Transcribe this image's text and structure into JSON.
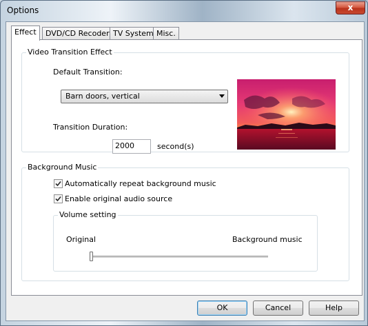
{
  "window": {
    "title": "Options",
    "close_glyph": "x"
  },
  "tabs": [
    {
      "label": "Effect",
      "active": true
    },
    {
      "label": "DVD/CD Recoder",
      "active": false
    },
    {
      "label": "TV System",
      "active": false
    },
    {
      "label": "Misc.",
      "active": false
    }
  ],
  "video_transition": {
    "group_title": "Video Transition Effect",
    "default_transition_label": "Default Transition:",
    "default_transition_value": "Barn doors, vertical",
    "duration_label": "Transition Duration:",
    "duration_value": "2000",
    "duration_unit": "second(s)",
    "preview_image": "sunset-preview"
  },
  "background_music": {
    "group_title": "Background Music",
    "repeat_label": "Automatically repeat background music",
    "repeat_checked": true,
    "original_audio_label": "Enable original audio source",
    "original_audio_checked": true,
    "volume": {
      "group_title": "Volume setting",
      "left_label": "Original",
      "right_label": "Background music",
      "level": 0
    }
  },
  "buttons": {
    "ok": "OK",
    "cancel": "Cancel",
    "help": "Help"
  },
  "colors": {
    "accent": "#3c7fb1",
    "close_button": "#c84a30"
  }
}
